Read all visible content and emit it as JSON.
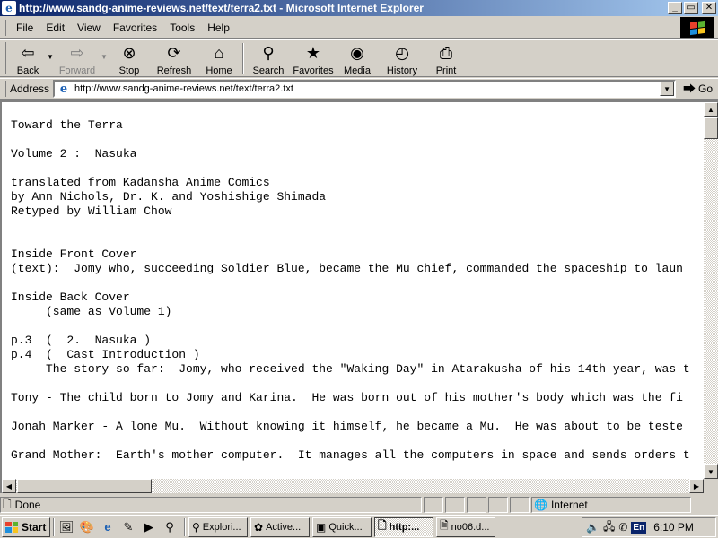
{
  "window": {
    "title": "http://www.sandg-anime-reviews.net/text/terra2.txt - Microsoft Internet Explorer",
    "minimize_glyph": "_",
    "maximize_glyph": "▭",
    "close_glyph": "✕"
  },
  "menu": {
    "items": [
      {
        "label": "File"
      },
      {
        "label": "Edit"
      },
      {
        "label": "View"
      },
      {
        "label": "Favorites"
      },
      {
        "label": "Tools"
      },
      {
        "label": "Help"
      }
    ]
  },
  "toolbar": {
    "back": "Back",
    "forward": "Forward",
    "stop": "Stop",
    "refresh": "Refresh",
    "home": "Home",
    "search": "Search",
    "favorites": "Favorites",
    "media": "Media",
    "history": "History",
    "print": "Print"
  },
  "address": {
    "label": "Address",
    "url": "http://www.sandg-anime-reviews.net/text/terra2.txt",
    "go_label": "Go"
  },
  "document": {
    "lines": [
      "Toward the Terra",
      "",
      "Volume 2 :  Nasuka",
      "",
      "translated from Kadansha Anime Comics",
      "by Ann Nichols, Dr. K. and Yoshishige Shimada",
      "Retyped by William Chow",
      "",
      "",
      "Inside Front Cover",
      "(text):  Jomy who, succeeding Soldier Blue, became the Mu chief, commanded the spaceship to laun",
      "",
      "Inside Back Cover",
      "     (same as Volume 1)",
      "",
      "p.3  (  2.  Nasuka )",
      "p.4  (  Cast Introduction )",
      "     The story so far:  Jomy, who received the \"Waking Day\" in Atarakusha of his 14th year, was t",
      "",
      "Tony - The child born to Jomy and Karina.  He was born out of his mother's body which was the fi",
      "",
      "Jonah Marker - A lone Mu.  Without knowing it himself, he became a Mu.  He was about to be teste",
      "",
      "Grand Mother:  Earth's mother computer.  It manages all the computers in space and sends orders t"
    ]
  },
  "status": {
    "text": "Done",
    "zone": "Internet"
  },
  "taskbar": {
    "start_label": "Start",
    "tasks": [
      {
        "label": "Explori..."
      },
      {
        "label": "Active..."
      },
      {
        "label": "Quick..."
      },
      {
        "label": "http:..."
      },
      {
        "label": "no06.d..."
      }
    ],
    "lang": "En",
    "clock": "6:10 PM"
  }
}
